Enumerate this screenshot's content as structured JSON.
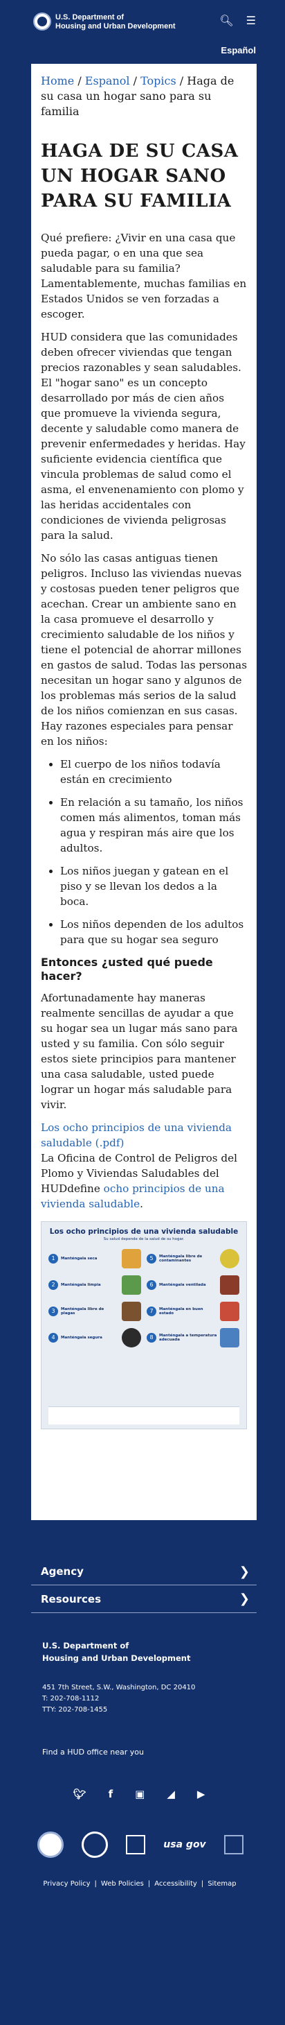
{
  "header": {
    "agency_line1": "U.S. Department of",
    "agency_line2": "Housing and Urban Development",
    "search_icon": "search-icon",
    "menu_icon": "menu-icon",
    "language_link": "Español"
  },
  "breadcrumb": {
    "home": "Home",
    "espanol": "Espanol",
    "topics": "Topics",
    "current": "Haga de su casa un hogar sano para su familia",
    "sep": " / "
  },
  "page_title": "HAGA DE SU CASA UN HOGAR SANO PARA SU FAMILIA",
  "body": {
    "p1": "Qué prefiere: ¿Vivir en una casa que pueda pagar, o en una que sea saludable para su familia? Lamentablemente, muchas familias en Estados Unidos se ven forzadas a escoger.",
    "p2": "HUD considera que las comunidades deben ofrecer viviendas que tengan precios razonables y sean saludables. El \"hogar sano\" es un concepto desarrollado por más de cien años que promueve la vivienda segura, decente y saludable como manera de prevenir enfermedades y heridas. Hay suficiente evidencia científica que vincula problemas de salud como el asma, el envenenamiento con plomo y las heridas accidentales con condiciones de vivienda peligrosas para la salud.",
    "p3": "No sólo las casas antiguas tienen peligros. Incluso las viviendas nuevas y costosas pueden tener peligros que acechan. Crear un ambiente sano en la casa promueve el desarrollo y crecimiento saludable de los niños y tiene el potencial de ahorrar millones en gastos de salud. Todas las personas necesitan un hogar sano y algunos de los problemas más serios de la salud de los niños comienzan en sus casas. Hay razones especiales para pensar en los niños:",
    "bullets": [
      "El cuerpo de los niños todavía están en crecimiento",
      "En relación a su tamaño, los niños comen más alimentos, toman más agua y respiran más aire que los adultos.",
      "Los niños juegan y gatean en el piso y se llevan los dedos a la boca.",
      "Los niños dependen de los adultos para que su hogar sea seguro"
    ],
    "subheading": "Entonces ¿usted qué puede hacer?",
    "p4": "Afortunadamente hay maneras realmente sencillas de ayudar a que su hogar sea un lugar más sano para usted y su familia. Con sólo seguir estos siete principios para mantener una casa saludable, usted puede lograr un hogar más saludable para vivir.",
    "pdf_link": "Los ocho principios de una vivienda saludable (.pdf)",
    "p5_prefix": "La Oficina de Control de Peligros del Plomo y Viviendas Saludables del HUDdefine ",
    "p5_link": "ocho principios de una vivienda saludable",
    "p5_suffix": "."
  },
  "infographic": {
    "title": "Los ocho principios de una vivienda saludable",
    "subtitle": "Su salud depende de la salud de su hogar.",
    "principles": [
      {
        "num": "1",
        "name": "Manténgala seca",
        "color": "#e0a23a"
      },
      {
        "num": "2",
        "name": "Manténgala limpia",
        "color": "#5a9a4a"
      },
      {
        "num": "3",
        "name": "Manténgala libre de plagas",
        "color": "#7b5230"
      },
      {
        "num": "4",
        "name": "Manténgala segura",
        "color": "#2b2b2b"
      },
      {
        "num": "5",
        "name": "Manténgala libre de contaminantes",
        "color": "#d9c23a"
      },
      {
        "num": "6",
        "name": "Manténgala ventilada",
        "color": "#8a3b2a"
      },
      {
        "num": "7",
        "name": "Manténgala en buen estado",
        "color": "#c94c3a"
      },
      {
        "num": "8",
        "name": "Manténgala a temperatura adecuada",
        "color": "#4a7fc0"
      }
    ]
  },
  "footer": {
    "nav": [
      {
        "label": "Agency"
      },
      {
        "label": "Resources"
      }
    ],
    "agency_line1": "U.S. Department of",
    "agency_line2": "Housing and Urban Development",
    "address": "451 7th Street, S.W., Washington, DC 20410",
    "phone": "T: 202-708-1112",
    "tty": "TTY: 202-708-1455",
    "find_office": "Find a HUD office near you",
    "social_icons": [
      "twitter-icon",
      "facebook-icon",
      "instagram-icon",
      "rss-icon",
      "youtube-icon"
    ],
    "usagov": "usa gov",
    "legal": [
      "Privacy Policy",
      "Web Policies",
      "Accessibility",
      "Sitemap"
    ],
    "legal_sep": "|"
  }
}
